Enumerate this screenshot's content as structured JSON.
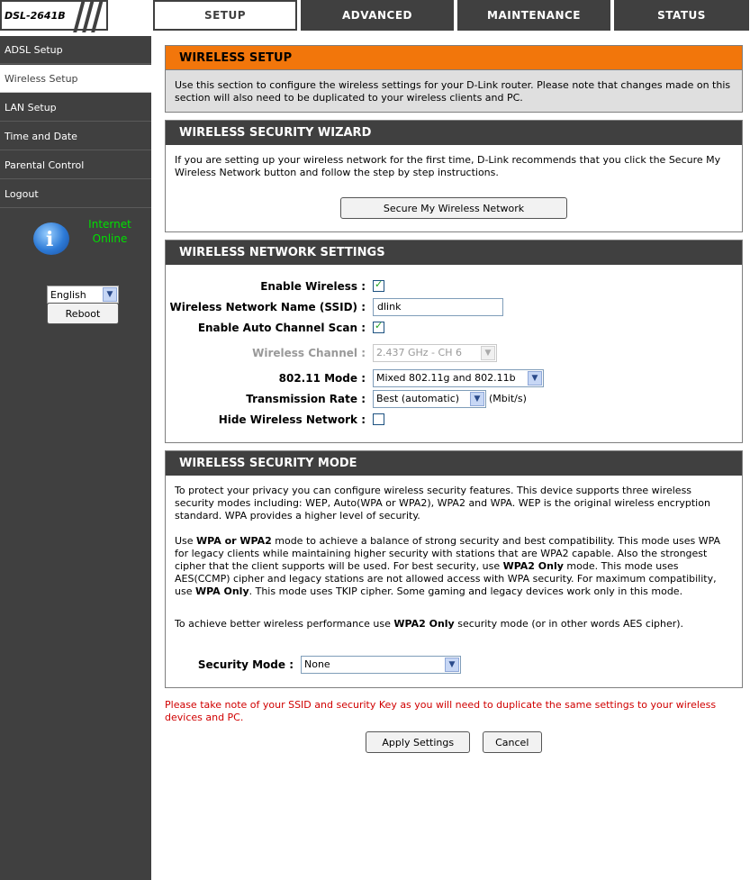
{
  "device": {
    "model": "DSL-2641B"
  },
  "nav": {
    "tabs": [
      "SETUP",
      "ADVANCED",
      "MAINTENANCE",
      "STATUS"
    ]
  },
  "sidebar": {
    "items": [
      "ADSL Setup",
      "Wireless Setup",
      "LAN Setup",
      "Time and Date",
      "Parental Control",
      "Logout"
    ],
    "status_line1": "Internet",
    "status_line2": "Online",
    "language": "English",
    "reboot": "Reboot"
  },
  "wireless_setup": {
    "title": "WIRELESS SETUP",
    "text": "Use this section to configure the wireless settings for your D-Link router. Please note that changes made on this section will also need to be duplicated to your wireless clients and PC."
  },
  "wizard": {
    "title": "WIRELESS SECURITY WIZARD",
    "text": "If you are setting up your wireless network for the first time, D-Link recommends that you click the Secure My Wireless Network button and follow the step by step instructions.",
    "button": "Secure My Wireless Network"
  },
  "network": {
    "title": "WIRELESS NETWORK SETTINGS",
    "enable_wireless_label": "Enable Wireless :",
    "ssid_label": "Wireless Network Name (SSID) :",
    "ssid_value": "dlink",
    "auto_channel_label": "Enable Auto Channel Scan :",
    "channel_label": "Wireless Channel :",
    "channel_value": "2.437 GHz - CH 6",
    "mode_label": "802.11 Mode :",
    "mode_value": "Mixed 802.11g and 802.11b",
    "rate_label": "Transmission Rate :",
    "rate_value": "Best (automatic)",
    "rate_unit": "(Mbit/s)",
    "hide_label": "Hide Wireless Network :"
  },
  "security": {
    "title": "WIRELESS SECURITY MODE",
    "para1": "To protect your privacy you can configure wireless security features. This device supports three wireless security modes including: WEP, Auto(WPA or WPA2), WPA2 and WPA. WEP is the original wireless encryption standard. WPA provides a higher level of security.",
    "p2_a": "Use ",
    "p2_b": "WPA or WPA2",
    "p2_c": " mode to achieve a balance of strong security and best compatibility. This mode uses WPA for legacy clients while maintaining higher security with stations that are WPA2 capable. Also the strongest cipher that the client supports will be used. For best security, use ",
    "p2_d": "WPA2 Only",
    "p2_e": " mode. This mode uses AES(CCMP) cipher and legacy stations are not allowed access with WPA security. For maximum compatibility, use ",
    "p2_f": "WPA Only",
    "p2_g": ". This mode uses TKIP cipher. Some gaming and legacy devices work only in this mode.",
    "p3_a": "To achieve better wireless performance use ",
    "p3_b": "WPA2 Only",
    "p3_c": " security mode (or in other words AES cipher).",
    "mode_label": "Security Mode :",
    "mode_value": "None"
  },
  "footer": {
    "note": "Please take note of your SSID and security Key as you will need to duplicate the same settings to your wireless devices and PC.",
    "apply": "Apply Settings",
    "cancel": "Cancel"
  }
}
